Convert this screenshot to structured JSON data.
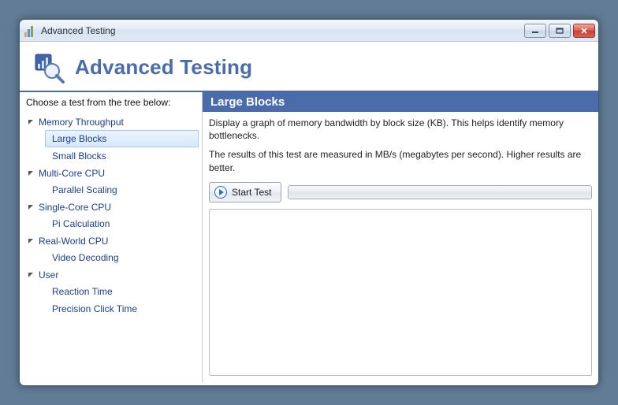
{
  "window": {
    "title": "Advanced Testing"
  },
  "header": {
    "title": "Advanced Testing"
  },
  "sidebar": {
    "prompt": "Choose a test from the tree below:",
    "groups": [
      {
        "label": "Memory Throughput",
        "items": [
          "Large Blocks",
          "Small Blocks"
        ]
      },
      {
        "label": "Multi-Core CPU",
        "items": [
          "Parallel Scaling"
        ]
      },
      {
        "label": "Single-Core CPU",
        "items": [
          "Pi Calculation"
        ]
      },
      {
        "label": "Real-World CPU",
        "items": [
          "Video Decoding"
        ]
      },
      {
        "label": "User",
        "items": [
          "Reaction Time",
          "Precision Click Time"
        ]
      }
    ],
    "selected": "Large Blocks"
  },
  "main": {
    "title": "Large Blocks",
    "description_1": "Display a graph of memory bandwidth by block size (KB). This helps identify memory bottlenecks.",
    "description_2": "The results of this test are measured in MB/s (megabytes per second). Higher results are better.",
    "start_label": "Start Test"
  },
  "colors": {
    "accent": "#4b6caa"
  }
}
